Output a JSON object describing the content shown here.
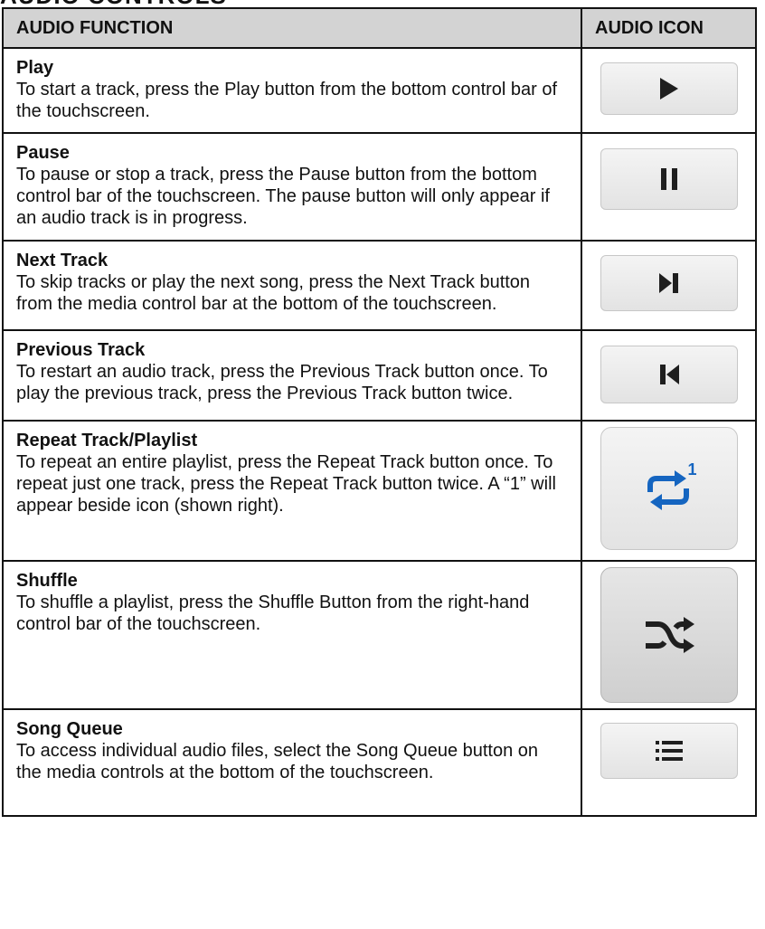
{
  "page": {
    "title": "AUDIO CONTROLS"
  },
  "table": {
    "headers": {
      "function": "AUDIO FUNCTION",
      "icon": "AUDIO ICON"
    },
    "rows": [
      {
        "title": "Play",
        "description": "To start a track, press the Play button from the bottom control bar of the touchscreen.",
        "icon": "play-icon"
      },
      {
        "title": "Pause",
        "description": "To pause or stop a track, press the Pause button from the bottom control bar of the touchscreen. The pause button will only appear if an audio track is in progress.",
        "icon": "pause-icon"
      },
      {
        "title": "Next Track",
        "description": "To skip tracks or play the next song, press the Next Track button from the media control bar at the bottom of the touchscreen.",
        "icon": "next-track-icon"
      },
      {
        "title": "Previous Track",
        "description": "To restart an audio track, press the Previous Track button once. To play the previous track, press the Previous Track button twice.",
        "icon": "previous-track-icon"
      },
      {
        "title": "Repeat Track/Playlist",
        "description": "To repeat an entire playlist, press the Repeat Track button once. To repeat just one track, press the Repeat Track button twice. A “1” will appear beside icon (shown right).",
        "icon": "repeat-one-icon",
        "icon_badge": "1"
      },
      {
        "title": "Shuffle",
        "description": "To shuffle a playlist, press the Shuffle Button from the right-hand control bar of the touchscreen.",
        "icon": "shuffle-icon"
      },
      {
        "title": "Song Queue",
        "description": "To access individual audio files, select the Song Queue button on the media controls at the bottom of the touchscreen.",
        "icon": "song-queue-icon"
      }
    ]
  },
  "colors": {
    "header_background": "#d3d3d3",
    "icon_dark": "#1f1f1f",
    "repeat_blue": "#1565c0"
  }
}
